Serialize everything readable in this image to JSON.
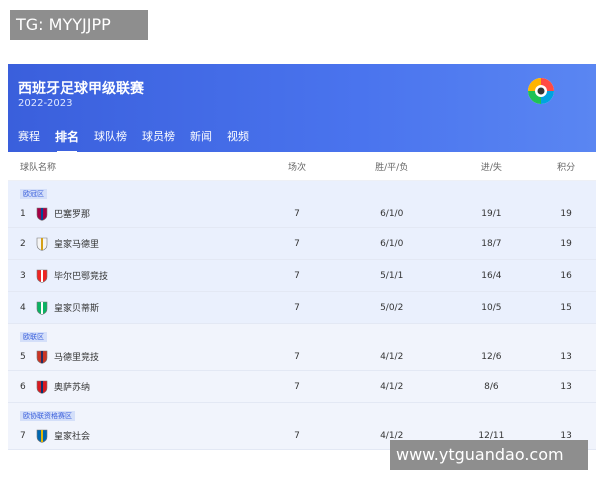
{
  "watermarks": {
    "top": "TG: MYYJJPP",
    "bottom": "www.ytguandao.com"
  },
  "header": {
    "title": "西班牙足球甲级联赛",
    "season": "2022-2023"
  },
  "tabs": [
    "赛程",
    "排名",
    "球队榜",
    "球员榜",
    "新闻",
    "视频"
  ],
  "active_tab": "排名",
  "table": {
    "columns": {
      "team": "球队名称",
      "played": "场次",
      "wdl": "胜/平/负",
      "goals": "进/失",
      "points": "积分"
    },
    "zones": {
      "ucl": "欧冠区",
      "uel": "欧联区",
      "uecl": "欧协联资格赛区"
    },
    "rows": [
      {
        "rank": "1",
        "team": "巴塞罗那",
        "played": "7",
        "wdl": "6/1/0",
        "goals": "19/1",
        "points": "19",
        "crest_color": "#a50044",
        "crest_color2": "#004d98"
      },
      {
        "rank": "2",
        "team": "皇家马德里",
        "played": "7",
        "wdl": "6/1/0",
        "goals": "18/7",
        "points": "19",
        "crest_color": "#f5f5f5",
        "crest_color2": "#d4a017"
      },
      {
        "rank": "3",
        "team": "毕尔巴鄂竞技",
        "played": "7",
        "wdl": "5/1/1",
        "goals": "16/4",
        "points": "16",
        "crest_color": "#ee2523",
        "crest_color2": "#ffffff"
      },
      {
        "rank": "4",
        "team": "皇家贝蒂斯",
        "played": "7",
        "wdl": "5/0/2",
        "goals": "10/5",
        "points": "15",
        "crest_color": "#0bb363",
        "crest_color2": "#ffffff"
      },
      {
        "rank": "5",
        "team": "马德里竞技",
        "played": "7",
        "wdl": "4/1/2",
        "goals": "12/6",
        "points": "13",
        "crest_color": "#cb3524",
        "crest_color2": "#272e61"
      },
      {
        "rank": "6",
        "team": "奥萨苏纳",
        "played": "7",
        "wdl": "4/1/2",
        "goals": "8/6",
        "points": "13",
        "crest_color": "#d91a21",
        "crest_color2": "#0a346f"
      },
      {
        "rank": "7",
        "team": "皇家社会",
        "played": "7",
        "wdl": "4/1/2",
        "goals": "12/11",
        "points": "13",
        "crest_color": "#0067b1",
        "crest_color2": "#e3b707"
      }
    ]
  },
  "colors": {
    "accent": "#3a5fdc",
    "ucl_bg": "#eaf0fd",
    "uel_bg": "#f1f4fc"
  }
}
